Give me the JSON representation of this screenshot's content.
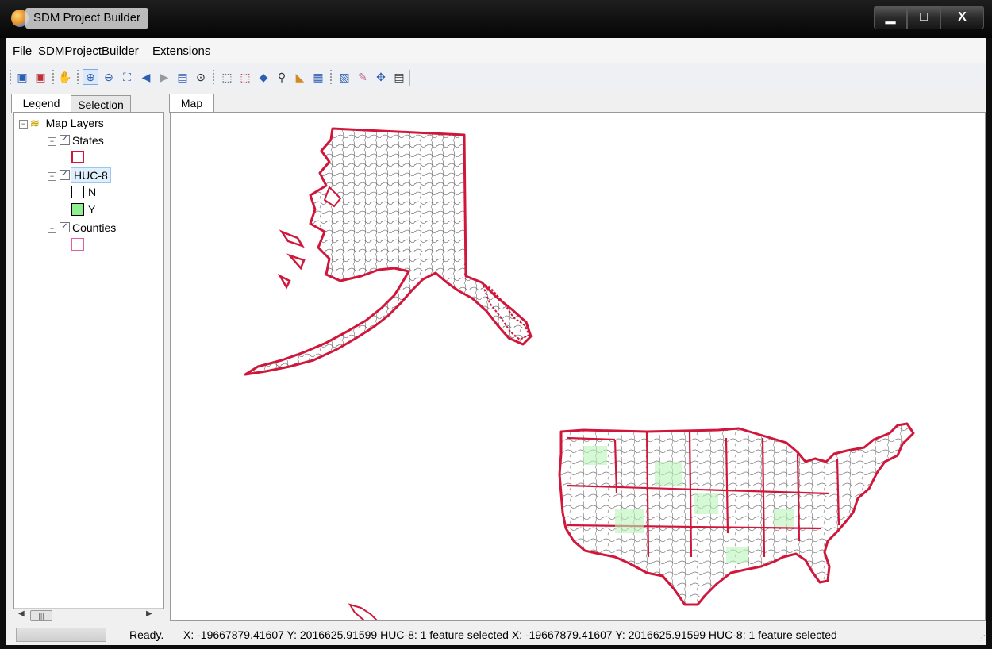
{
  "window": {
    "title": "SDM Project Builder"
  },
  "menu": [
    "File",
    "SDMProjectBuilder",
    "Extensions"
  ],
  "tabs": {
    "legend": "Legend",
    "selection": "Selection",
    "map": "Map"
  },
  "legend": {
    "root": "Map Layers",
    "layers": [
      {
        "name": "States",
        "checked": true,
        "swatches": [
          {
            "label": "",
            "fill": "#ffffff",
            "stroke": "#d0163a"
          }
        ]
      },
      {
        "name": "HUC-8",
        "checked": true,
        "selected": true,
        "swatches": [
          {
            "label": "N",
            "fill": "#ffffff",
            "stroke": "#000000"
          },
          {
            "label": "Y",
            "fill": "#8ef08e",
            "stroke": "#000000"
          }
        ]
      },
      {
        "name": "Counties",
        "checked": true,
        "swatches": [
          {
            "label": "",
            "fill": "#ffffff",
            "stroke": "#e0609a"
          }
        ]
      }
    ]
  },
  "status": {
    "ready": "Ready.",
    "coords": "X: -19667879.41607  Y: 2016625.91599  HUC-8: 1 feature selected  X: -19667879.41607  Y: 2016625.91599  HUC-8: 1 feature selected"
  },
  "colors": {
    "state_border": "#d0163a",
    "huc_selected": "#b9f3b9",
    "huc_line": "#555555"
  }
}
